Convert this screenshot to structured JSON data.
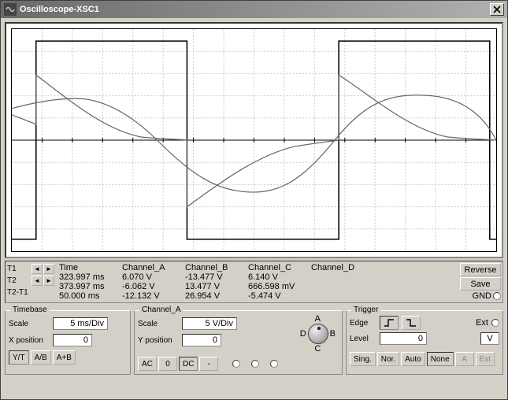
{
  "window": {
    "title": "Oscilloscope-XSC1"
  },
  "readout": {
    "headers": {
      "time": "Time",
      "cha": "Channel_A",
      "chb": "Channel_B",
      "chc": "Channel_C",
      "chd": "Channel_D"
    },
    "cursors": {
      "t1": "T1",
      "t2": "T2",
      "diff": "T2-T1"
    },
    "t1": {
      "time": "323.997 ms",
      "cha": "6.070 V",
      "chb": "-13.477 V",
      "chc": "6.140 V",
      "chd": ""
    },
    "t2": {
      "time": "373.997 ms",
      "cha": "-6.062 V",
      "chb": "13.477 V",
      "chc": "666.598 mV",
      "chd": ""
    },
    "diff": {
      "time": "50.000 ms",
      "cha": "-12.132 V",
      "chb": "26.954 V",
      "chc": "-5.474 V",
      "chd": ""
    },
    "side": {
      "reverse": "Reverse",
      "save": "Save",
      "gnd": "GND"
    }
  },
  "timebase": {
    "title": "Timebase",
    "scale_label": "Scale",
    "scale_value": "5 ms/Div",
    "xpos_label": "X position",
    "xpos_value": "0",
    "buttons": {
      "yt": "Y/T",
      "ab": "A/B",
      "aplusb": "A+B"
    }
  },
  "channel": {
    "title": "Channel_A",
    "scale_label": "Scale",
    "scale_value": "5  V/Div",
    "ypos_label": "Y position",
    "ypos_value": "0",
    "buttons": {
      "ac": "AC",
      "zero": "0",
      "dc": "DC",
      "minus": "-"
    },
    "dial": {
      "top": "A",
      "bottom": "C",
      "left": "D",
      "right": "B"
    }
  },
  "trigger": {
    "title": "Trigger",
    "edge_label": "Edge",
    "level_label": "Level",
    "level_value": "0",
    "level_unit": "V",
    "ext_label": "Ext",
    "buttons": {
      "sing": "Sing.",
      "nor": "Nor.",
      "auto": "Auto",
      "none": "None",
      "a": "A",
      "ext": "Ext"
    }
  },
  "chart_data": {
    "type": "line",
    "title": "",
    "xlabel": "",
    "ylabel": "",
    "x_unit": "ms",
    "y_unit": "V",
    "x_range_ms": [
      320,
      400
    ],
    "timebase_ms_per_div": 5,
    "vscale_v_per_div": 5,
    "divisions_x": 16,
    "divisions_y": 10,
    "grid": true,
    "series": [
      {
        "name": "Channel_A",
        "description": "sine-like wave, amplitude approx 6 V, period approx 50 ms",
        "x_ms": [
          320,
          324,
          330,
          336,
          345,
          350,
          355,
          364,
          370,
          374,
          380,
          395,
          400
        ],
        "y_v": [
          5.0,
          6.07,
          5.5,
          3.0,
          0.0,
          -3.0,
          -5.5,
          -6.3,
          -6.2,
          -6.06,
          -5.0,
          0.0,
          3.0
        ]
      },
      {
        "name": "Channel_B",
        "description": "square wave, approx ±13.5 V, period approx 50 ms",
        "x_ms": [
          320,
          330,
          330,
          355,
          355,
          380,
          380,
          400
        ],
        "y_v": [
          -13.48,
          -13.48,
          13.48,
          13.48,
          -13.48,
          -13.48,
          13.48,
          13.48
        ]
      },
      {
        "name": "Channel_C",
        "description": "capacitor-like charge/discharge curve",
        "x_ms": [
          320,
          324,
          328,
          334,
          345,
          350,
          355,
          360,
          370,
          374,
          380,
          390,
          400
        ],
        "y_v": [
          8.0,
          6.14,
          4.0,
          2.0,
          0.5,
          0.2,
          -8.0,
          -5.0,
          -1.5,
          0.67,
          0.3,
          8.0,
          5.0
        ]
      }
    ]
  }
}
